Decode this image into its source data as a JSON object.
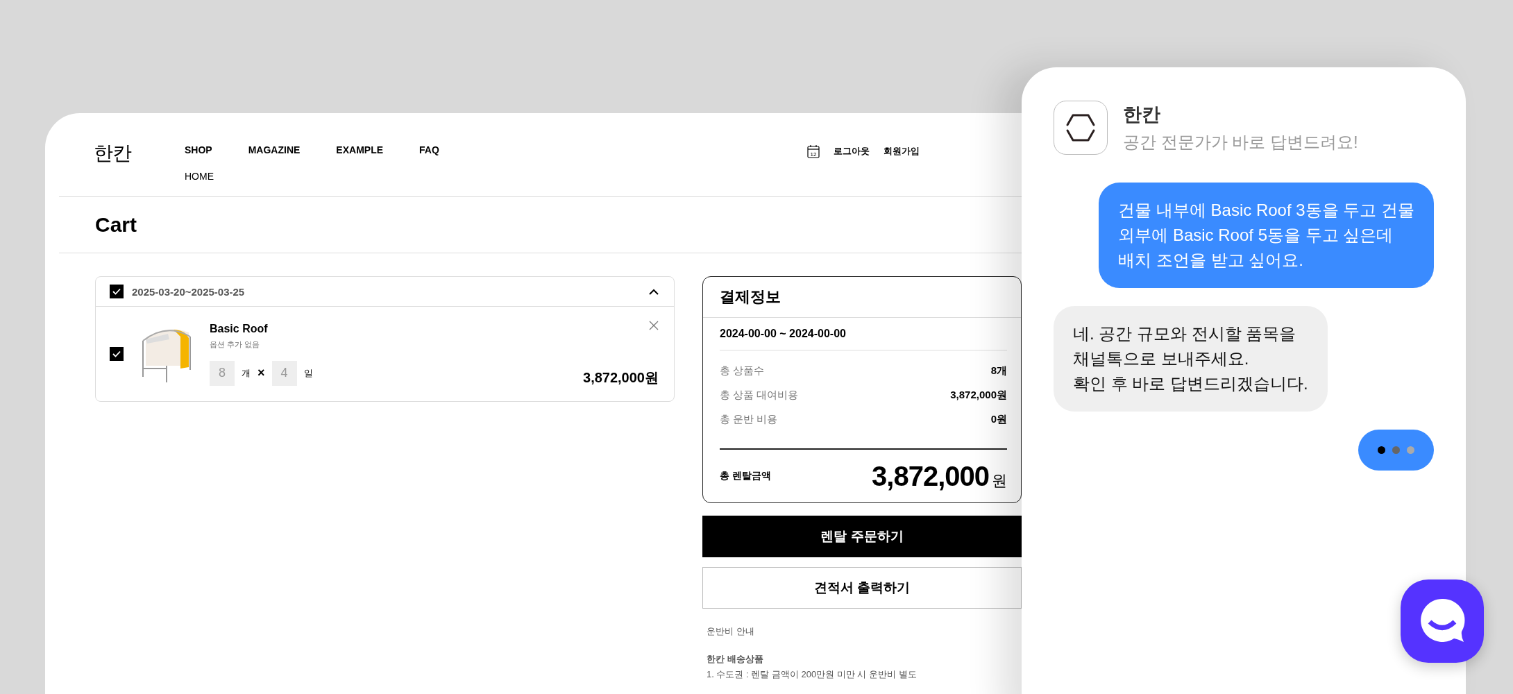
{
  "site": {
    "logo": "한칸",
    "nav": [
      {
        "label": "SHOP"
      },
      {
        "label": "MAGAZINE"
      },
      {
        "label": "EXAMPLE"
      },
      {
        "label": "FAQ"
      }
    ],
    "subnav": "HOME",
    "calendar_day": "12",
    "account_links": [
      "로그아웃",
      "회원가입"
    ]
  },
  "page_title": "Cart",
  "cart_group": {
    "checked": true,
    "dates": "2025-03-20~2025-03-25",
    "expanded": true,
    "items": [
      {
        "checked": true,
        "name": "Basic Roof",
        "option": "옵션 추가 없음",
        "quantity": "8",
        "quantity_unit": "개",
        "times": "×",
        "days": "4",
        "days_unit": "일",
        "price": "3,872,000원"
      }
    ]
  },
  "payment": {
    "title": "결제정보",
    "period": "2024-00-00 ~ 2024-00-00",
    "rows": [
      {
        "label": "총 상품수",
        "value": "8개"
      },
      {
        "label": "총 상품 대여비용",
        "value": "3,872,000원"
      },
      {
        "label": "총 운반 비용",
        "value": "0원"
      }
    ],
    "total_label": "총 렌탈금액",
    "total_amount": "3,872,000",
    "total_unit": "원"
  },
  "buttons": [
    {
      "label": "렌탈 주문하기",
      "kind": "primary"
    },
    {
      "label": "견적서 출력하기",
      "kind": "secondary"
    }
  ],
  "shipping_note": {
    "title": "운반비 안내",
    "heading": "한칸 배송상품",
    "lines": [
      "1. 수도권 : 렌탈 금액이 200만원 미만 시 운반비 별도"
    ]
  },
  "chat": {
    "name": "한칸",
    "subtitle": "공간 전문가가 바로 답변드려요!",
    "messages": [
      {
        "kind": "user",
        "lines": [
          "건물 내부에 Basic Roof 3동을 두고 건물",
          "외부에 Basic Roof  5동을 두고 싶은데",
          "배치 조언을 받고 싶어요."
        ]
      },
      {
        "kind": "bot",
        "lines": [
          "네. 공간 규모와 전시할 품목을",
          "채널톡으로 보내주세요.",
          "확인 후 바로 답변드리겠습니다."
        ]
      },
      {
        "kind": "typing"
      }
    ]
  }
}
